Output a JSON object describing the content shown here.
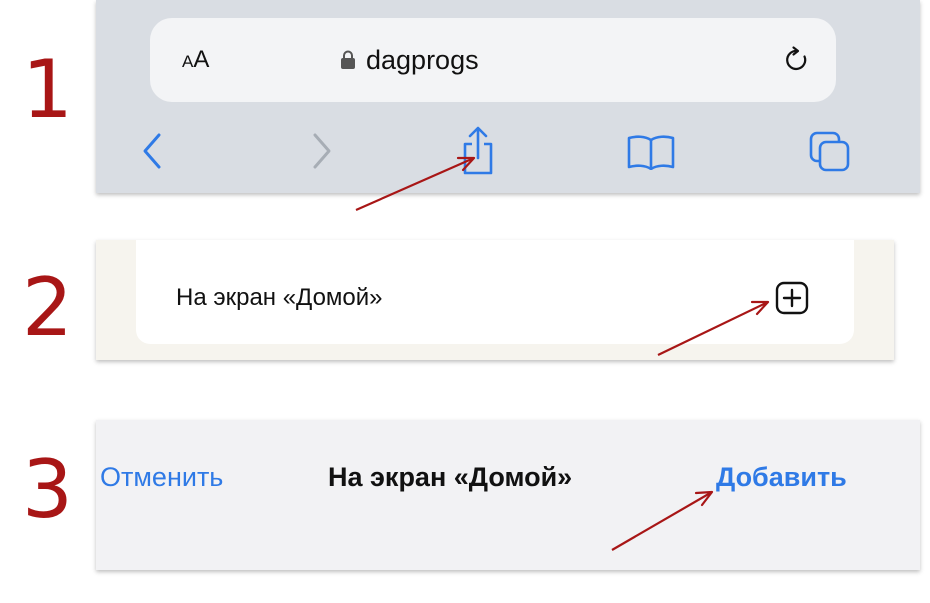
{
  "steps": [
    {
      "number": "1"
    },
    {
      "number": "2"
    },
    {
      "number": "3"
    }
  ],
  "browser": {
    "text_size_small": "A",
    "text_size_large": "A",
    "url": "dagprogs",
    "icons": {
      "lock": "lock-icon",
      "reload": "reload-icon",
      "back": "chevron-left-icon",
      "forward": "chevron-right-icon",
      "share": "share-icon",
      "bookmarks": "book-icon",
      "tabs": "tabs-icon"
    }
  },
  "share_menu": {
    "item_label": "На экран «Домой»",
    "item_icon": "plus-square-icon"
  },
  "add_sheet": {
    "cancel_label": "Отменить",
    "title": "На экран «Домой»",
    "add_label": "Добавить"
  },
  "colors": {
    "accent": "#2f7ae6",
    "step_number": "#a81616",
    "arrow": "#a81616",
    "toolbar_bg": "#d9dde3"
  }
}
